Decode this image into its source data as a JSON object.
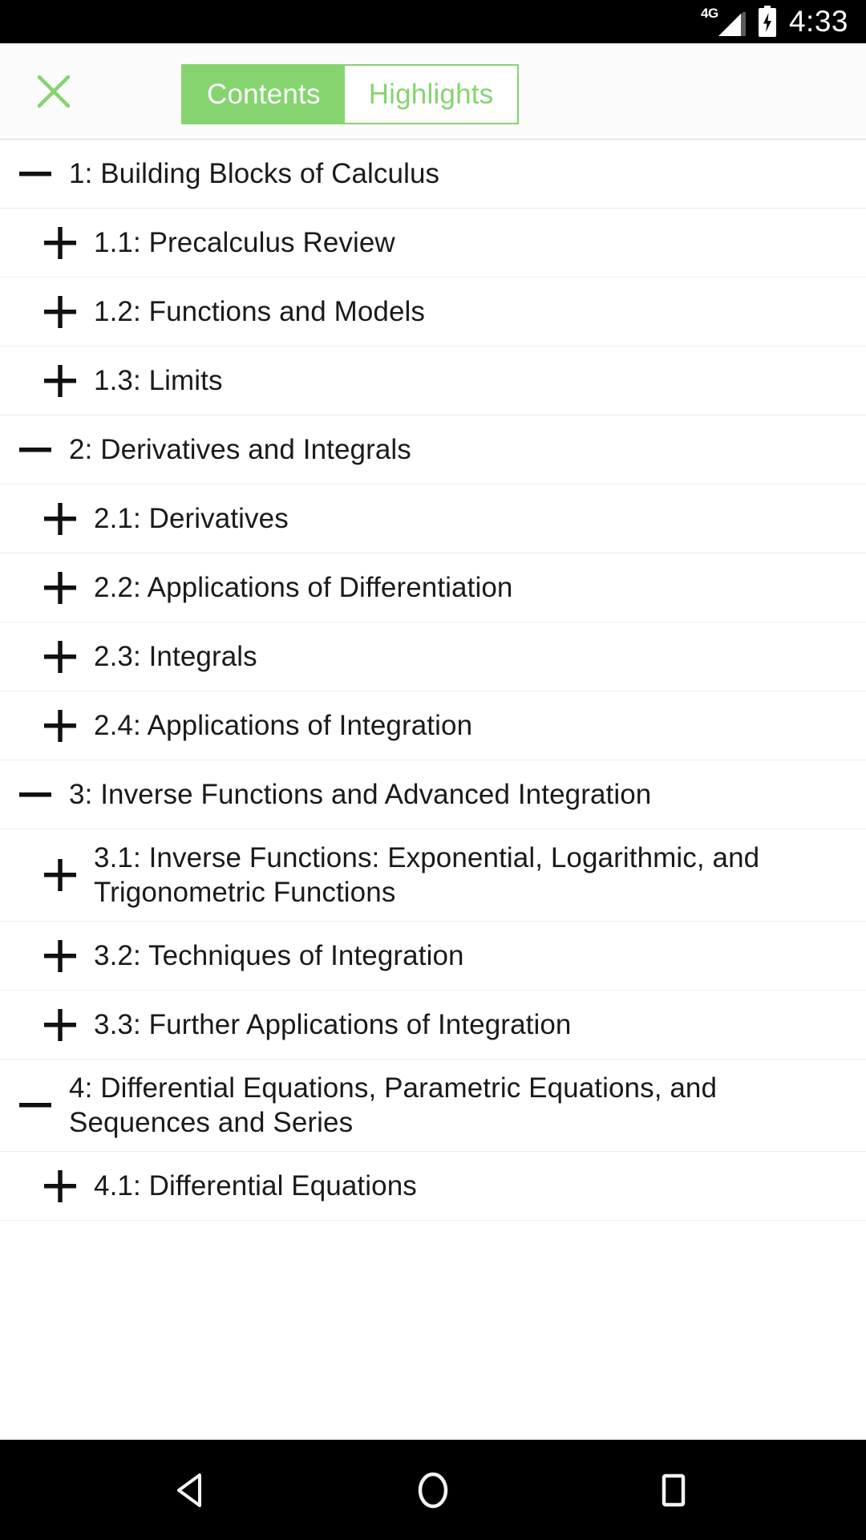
{
  "status_bar": {
    "network_label": "4G",
    "signal_icon": "signal-bars-icon",
    "battery_icon": "battery-charging-icon",
    "time": "4:33"
  },
  "header": {
    "close_icon": "close-icon",
    "tabs": [
      {
        "label": "Contents",
        "active": true
      },
      {
        "label": "Highlights",
        "active": false
      }
    ],
    "accent_color": "#85d470"
  },
  "toc": {
    "items": [
      {
        "level": 1,
        "toggle": "minus-icon",
        "label": "1: Building Blocks of Calculus"
      },
      {
        "level": 2,
        "toggle": "plus-icon",
        "label": "1.1: Precalculus Review"
      },
      {
        "level": 2,
        "toggle": "plus-icon",
        "label": "1.2: Functions and Models"
      },
      {
        "level": 2,
        "toggle": "plus-icon",
        "label": "1.3: Limits"
      },
      {
        "level": 1,
        "toggle": "minus-icon",
        "label": "2: Derivatives and Integrals"
      },
      {
        "level": 2,
        "toggle": "plus-icon",
        "label": "2.1: Derivatives"
      },
      {
        "level": 2,
        "toggle": "plus-icon",
        "label": "2.2: Applications of Differentiation"
      },
      {
        "level": 2,
        "toggle": "plus-icon",
        "label": "2.3: Integrals"
      },
      {
        "level": 2,
        "toggle": "plus-icon",
        "label": "2.4: Applications of Integration"
      },
      {
        "level": 1,
        "toggle": "minus-icon",
        "label": "3: Inverse Functions and Advanced Integration"
      },
      {
        "level": 2,
        "toggle": "plus-icon",
        "label": "3.1: Inverse Functions: Exponential, Logarithmic, and Trigonometric Functions"
      },
      {
        "level": 2,
        "toggle": "plus-icon",
        "label": "3.2: Techniques of Integration"
      },
      {
        "level": 2,
        "toggle": "plus-icon",
        "label": "3.3: Further Applications of Integration"
      },
      {
        "level": 1,
        "toggle": "minus-icon",
        "label": "4: Differential Equations, Parametric Equations, and Sequences and Series"
      },
      {
        "level": 2,
        "toggle": "plus-icon",
        "label": "4.1: Differential Equations"
      }
    ]
  },
  "nav_bar": {
    "buttons": [
      {
        "name": "back-icon"
      },
      {
        "name": "home-icon"
      },
      {
        "name": "recents-icon"
      }
    ]
  }
}
